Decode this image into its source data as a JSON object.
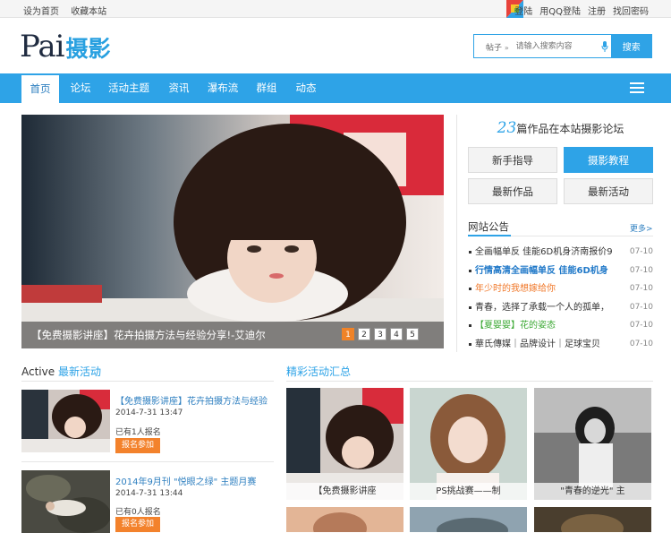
{
  "topbar": {
    "set_home": "设为首页",
    "bookmark": "收藏本站",
    "login": "登陆",
    "qq_login": "用QQ登陆",
    "register": "注册",
    "find_password": "找回密码"
  },
  "logo": {
    "en": "Pai",
    "cn": "摄影"
  },
  "search": {
    "type_label": "帖子",
    "placeholder": "请输入搜索内容",
    "button": "搜索"
  },
  "nav": {
    "items": [
      "首页",
      "论坛",
      "活动主题",
      "资讯",
      "瀑布流",
      "群组",
      "动态"
    ]
  },
  "banner": {
    "caption": "【免费摄影讲座】花卉拍摄方法与经验分享!-艾迪尔",
    "pages": [
      "1",
      "2",
      "3",
      "4",
      "5"
    ]
  },
  "stats": {
    "count": "23",
    "text": "篇作品在本站摄影论坛"
  },
  "quick": {
    "newbie": "新手指导",
    "tutorial": "摄影教程",
    "latest_works": "最新作品",
    "latest_events": "最新活动"
  },
  "notice": {
    "title": "网站公告",
    "more": "更多>",
    "items": [
      {
        "text": "全画幅单反 佳能6D机身济南报价9",
        "date": "07-10",
        "color": "#333333"
      },
      {
        "text": "行情高清全画幅单反 佳能6D机身",
        "date": "07-10",
        "color": "#1f78c8"
      },
      {
        "text": "年少时的我想嫁给你",
        "date": "07-10",
        "color": "#f0782a"
      },
      {
        "text": "青春，选择了承载一个人的孤单，",
        "date": "07-10",
        "color": "#333333"
      },
      {
        "text": "【夏婴婴】花的姿态",
        "date": "07-10",
        "color": "#3aa832"
      },
      {
        "text": "華氏傳媒｜品牌设计｜足球宝贝",
        "date": "07-10",
        "color": "#333333"
      }
    ]
  },
  "activity": {
    "title_en": "Active",
    "title_cn": "最新活动",
    "items": [
      {
        "title": "【免费摄影讲座】花卉拍摄方法与经验",
        "date": "2014-7-31 13:47",
        "signed": "已有1人报名",
        "button": "报名参加"
      },
      {
        "title": "2014年9月刊 \"悦眼之绿\" 主题月赛",
        "date": "2014-7-31 13:44",
        "signed": "已有0人报名",
        "button": "报名参加"
      }
    ]
  },
  "gallery": {
    "title": "精彩活动汇总",
    "items": [
      {
        "caption": "【免费摄影讲座"
      },
      {
        "caption": "PS挑战赛——制"
      },
      {
        "caption": "\"青春的逆光\" 主"
      }
    ]
  }
}
